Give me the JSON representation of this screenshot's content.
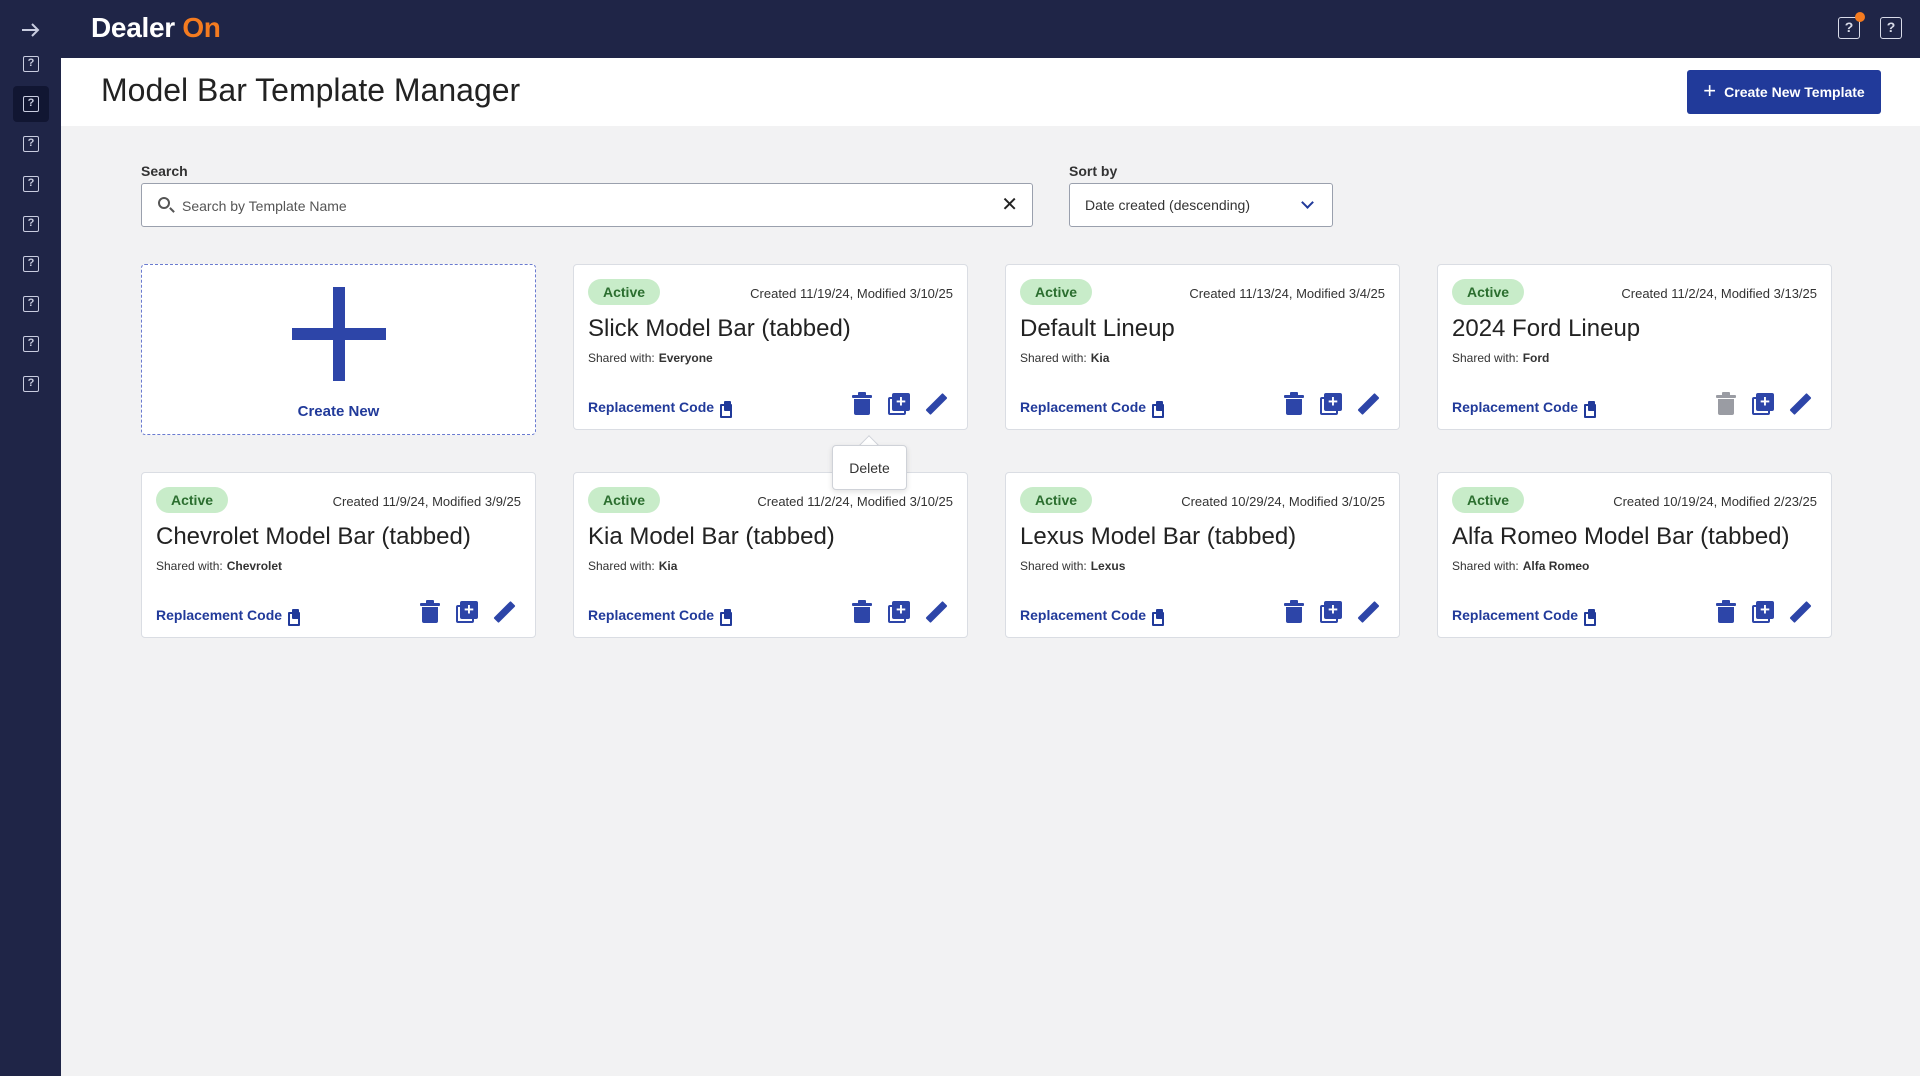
{
  "app": {
    "logo_main": "Dealer",
    "logo_accent": "On",
    "brand_color": "#1f2547",
    "accent_color": "#f47b20",
    "primary_color": "#213a9a"
  },
  "rail": {
    "expand_icon": "arrow-right-icon",
    "items": [
      "help-square-icon",
      "help-square-icon",
      "help-square-icon",
      "help-square-icon",
      "help-square-icon",
      "help-square-icon",
      "help-square-icon",
      "help-square-icon",
      "help-square-icon"
    ]
  },
  "topbar": {
    "notification_icon": "help-square-icon",
    "help_icon": "help-square-icon"
  },
  "header": {
    "title": "Model Bar Template Manager",
    "create_button": "Create New Template"
  },
  "filters": {
    "search_label": "Search",
    "search_placeholder": "Search by Template Name",
    "search_value": "",
    "sort_label": "Sort by",
    "sort_value": "Date created (descending)"
  },
  "create_card": {
    "label": "Create New"
  },
  "tooltip": {
    "text": "Delete"
  },
  "cards": [
    {
      "status": "Active",
      "dates": "Created 11/19/24, Modified 3/10/25",
      "title": "Slick Model Bar (tabbed)",
      "shared_label": "Shared with:",
      "shared_with": "Everyone",
      "code_label": "Replacement Code",
      "delete_enabled": true
    },
    {
      "status": "Active",
      "dates": "Created 11/13/24, Modified 3/4/25",
      "title": "Default Lineup",
      "shared_label": "Shared with:",
      "shared_with": "Kia",
      "code_label": "Replacement Code",
      "delete_enabled": true
    },
    {
      "status": "Active",
      "dates": "Created 11/2/24, Modified 3/13/25",
      "title": "2024 Ford Lineup",
      "shared_label": "Shared with:",
      "shared_with": "Ford",
      "code_label": "Replacement Code",
      "delete_enabled": false
    },
    {
      "status": "Active",
      "dates": "Created 11/9/24, Modified 3/9/25",
      "title": "Chevrolet Model Bar (tabbed)",
      "shared_label": "Shared with:",
      "shared_with": "Chevrolet",
      "code_label": "Replacement Code",
      "delete_enabled": true
    },
    {
      "status": "Active",
      "dates": "Created 11/2/24, Modified 3/10/25",
      "title": "Kia Model Bar (tabbed)",
      "shared_label": "Shared with:",
      "shared_with": "Kia",
      "code_label": "Replacement Code",
      "delete_enabled": true
    },
    {
      "status": "Active",
      "dates": "Created 10/29/24, Modified 3/10/25",
      "title": "Lexus Model Bar (tabbed)",
      "shared_label": "Shared with:",
      "shared_with": "Lexus",
      "code_label": "Replacement Code",
      "delete_enabled": true
    },
    {
      "status": "Active",
      "dates": "Created 10/19/24, Modified 2/23/25",
      "title": "Alfa Romeo Model Bar (tabbed)",
      "shared_label": "Shared with:",
      "shared_with": "Alfa Romeo",
      "code_label": "Replacement Code",
      "delete_enabled": true
    }
  ]
}
